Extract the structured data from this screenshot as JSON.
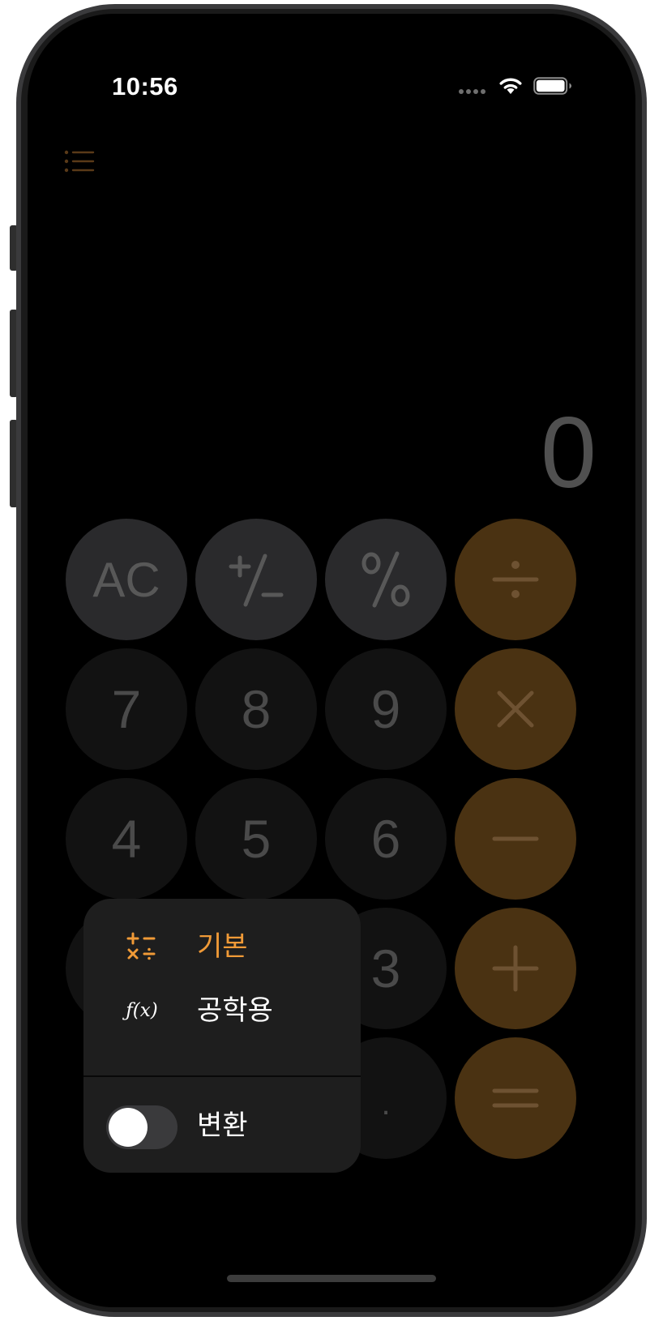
{
  "status_bar": {
    "time": "10:56"
  },
  "display": {
    "value": "0"
  },
  "keys": {
    "ac": "AC",
    "seven": "7",
    "eight": "8",
    "nine": "9",
    "four": "4",
    "five": "5",
    "six": "6",
    "three": "3",
    "decimal": "."
  },
  "mode_menu": {
    "basic": {
      "label": "기본",
      "icon": "basic-operators-icon",
      "selected": true
    },
    "scientific": {
      "label": "공학용",
      "icon": "function-icon",
      "icon_text": "ƒ(x)"
    },
    "convert": {
      "label": "변환",
      "toggle_on": false
    }
  },
  "colors": {
    "accent": "#f09a37",
    "operator_key": "#4a3212",
    "function_key": "#2a2a2c",
    "number_key": "#121212",
    "menu_background": "#1e1e1e"
  }
}
